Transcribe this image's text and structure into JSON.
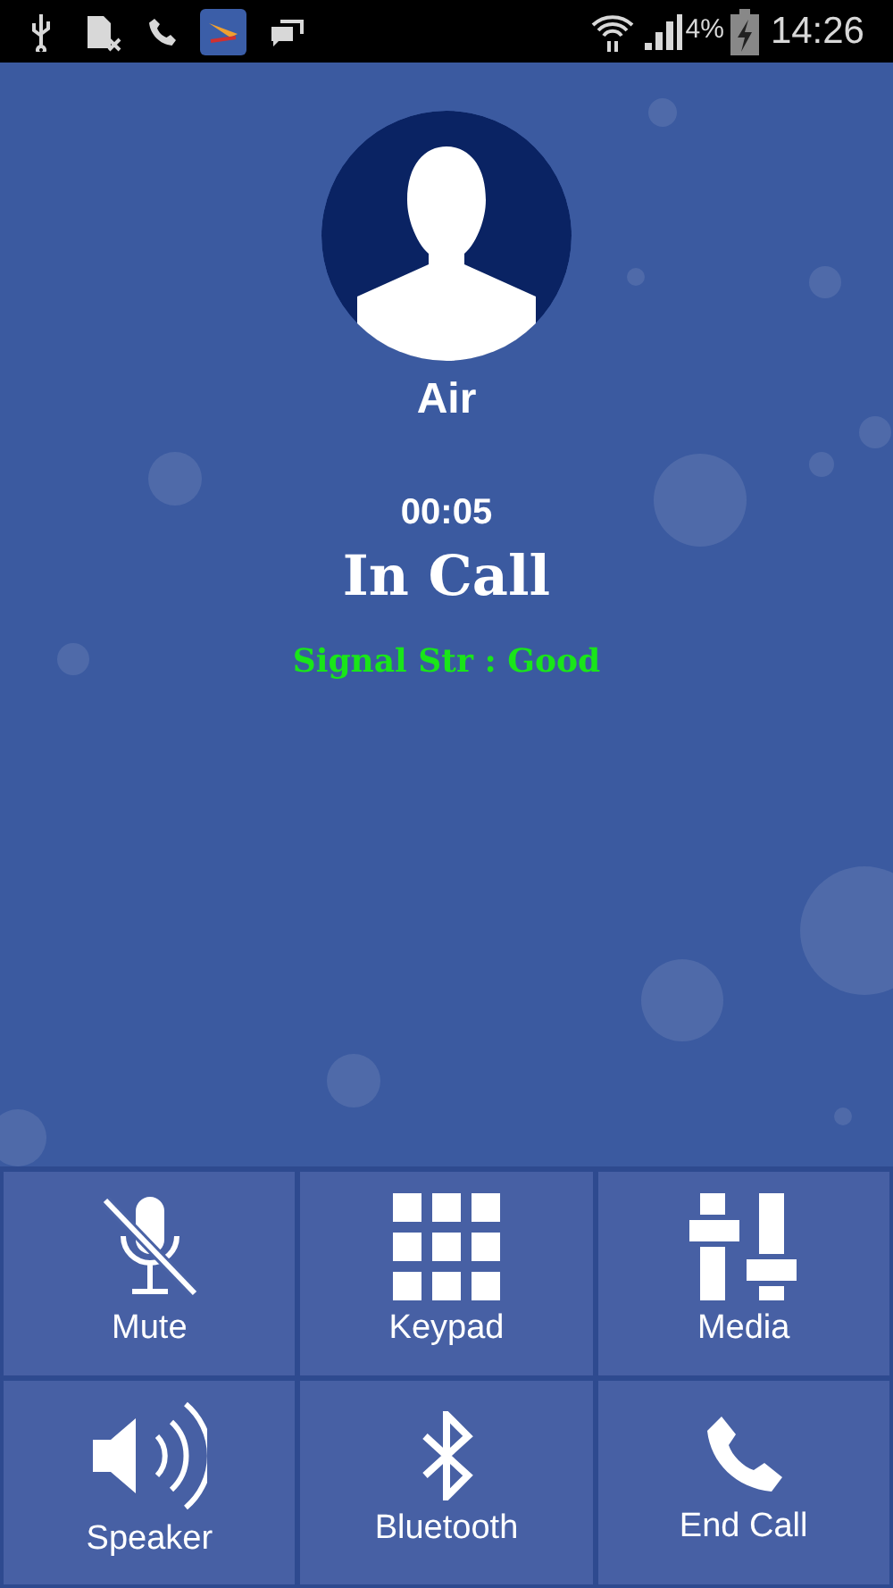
{
  "status_bar": {
    "battery": "4%",
    "time": "14:26"
  },
  "caller": {
    "name": "Air",
    "duration": "00:05",
    "state": "In Call",
    "signal": "Signal Str : Good"
  },
  "buttons": [
    {
      "kind": "mute",
      "label": "Mute"
    },
    {
      "kind": "keypad",
      "label": "Keypad"
    },
    {
      "kind": "media",
      "label": "Media"
    },
    {
      "kind": "speaker",
      "label": "Speaker"
    },
    {
      "kind": "bluetooth",
      "label": "Bluetooth"
    },
    {
      "kind": "end",
      "label": "End Call"
    }
  ]
}
